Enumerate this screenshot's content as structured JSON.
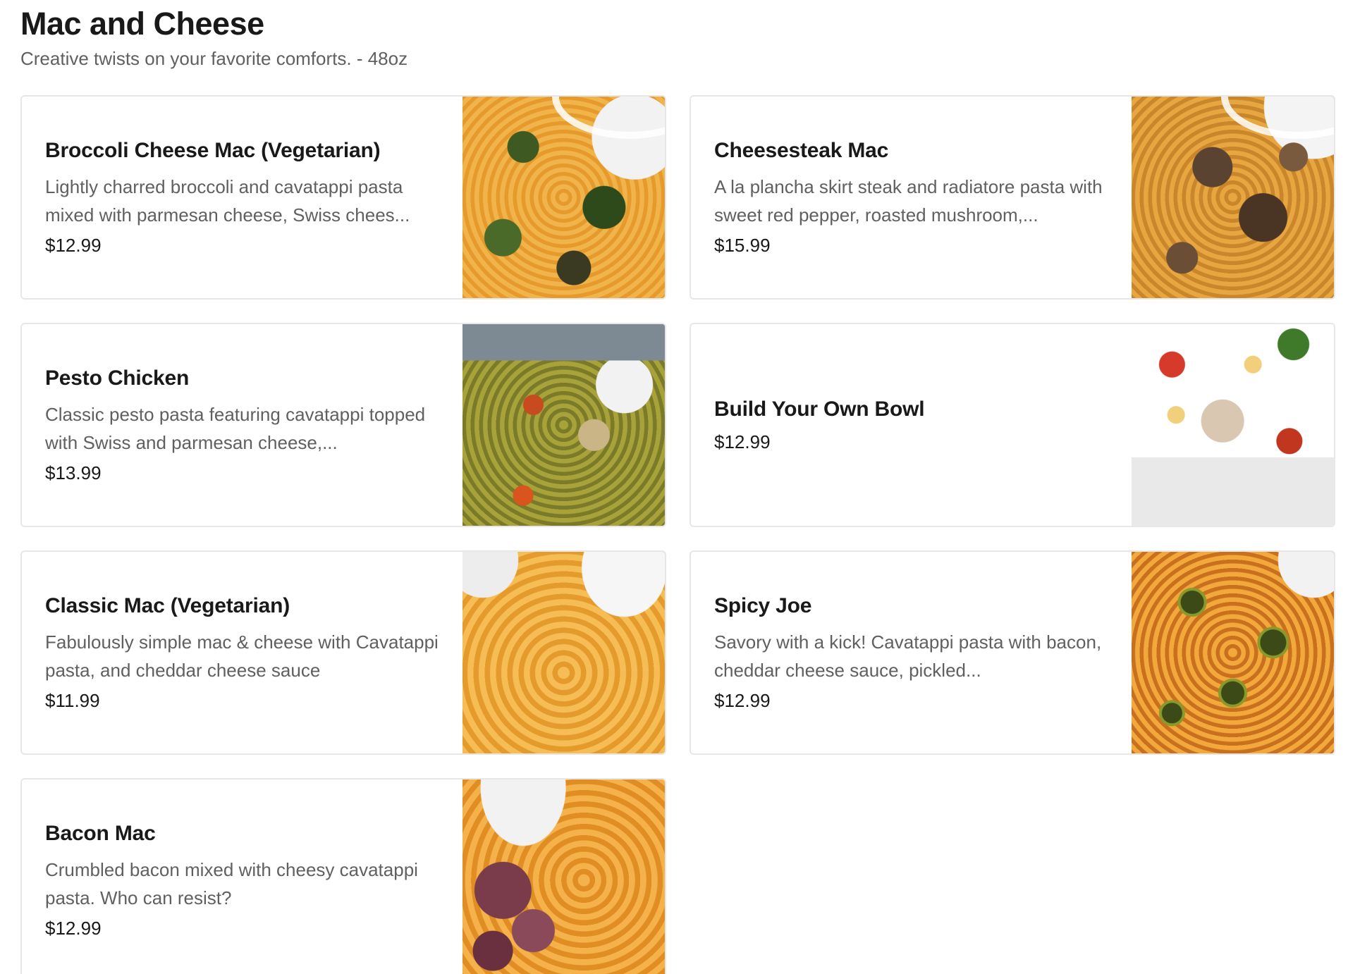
{
  "section": {
    "title": "Mac and Cheese",
    "subtitle": "Creative twists on your favorite comforts. - 48oz"
  },
  "items": [
    {
      "name": "Broccoli Cheese Mac (Vegetarian)",
      "description": "Lightly charred broccoli and cavatappi pasta mixed with parmesan cheese, Swiss chees...",
      "price": "$12.99",
      "image": "broccoli-mac-photo"
    },
    {
      "name": "Cheesesteak Mac",
      "description": "A la plancha skirt steak and radiatore pasta with sweet red pepper, roasted mushroom,...",
      "price": "$15.99",
      "image": "cheesesteak-mac-photo"
    },
    {
      "name": "Pesto Chicken",
      "description": "Classic pesto pasta featuring cavatappi topped with Swiss and parmesan cheese,...",
      "price": "$13.99",
      "image": "pesto-chicken-photo"
    },
    {
      "name": "Build Your Own Bowl",
      "description": "",
      "price": "$12.99",
      "image": "build-your-own-bowl-photo"
    },
    {
      "name": "Classic Mac (Vegetarian)",
      "description": "Fabulously simple mac & cheese with Cavatappi pasta, and cheddar cheese sauce",
      "price": "$11.99",
      "image": "classic-mac-photo"
    },
    {
      "name": "Spicy Joe",
      "description": "Savory with a kick! Cavatappi pasta with bacon, cheddar cheese sauce, pickled...",
      "price": "$12.99",
      "image": "spicy-joe-photo"
    },
    {
      "name": "Bacon Mac",
      "description": "Crumbled bacon mixed with cheesy cavatappi pasta. Who can resist?",
      "price": "$12.99",
      "image": "bacon-mac-photo"
    }
  ]
}
